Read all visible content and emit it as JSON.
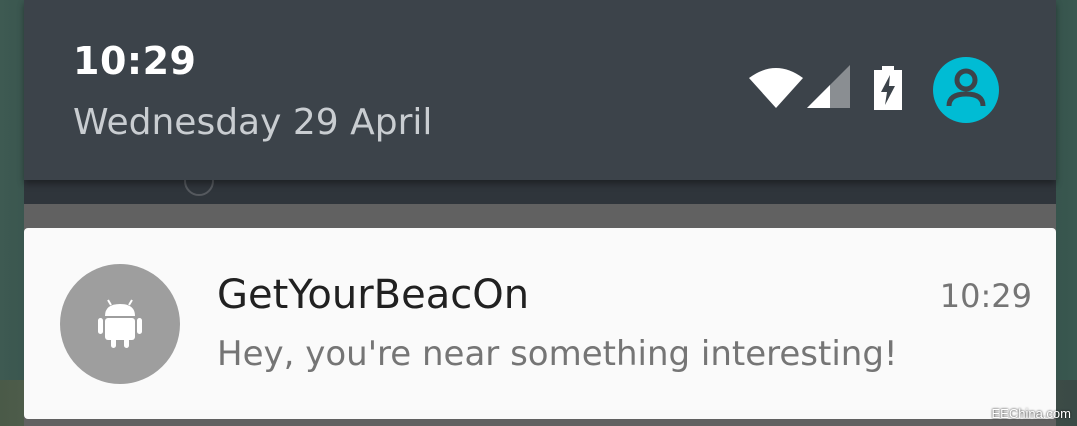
{
  "header": {
    "time": "10:29",
    "date": "Wednesday 29 April"
  },
  "status_icons": {
    "wifi": "wifi-icon",
    "signal": "cell-signal-icon",
    "battery": "battery-charging-icon",
    "user": "account-circle-icon"
  },
  "notification": {
    "app_icon": "android-icon",
    "title": "GetYourBeacOn",
    "time": "10:29",
    "text": "Hey, you're near something interesting!"
  },
  "colors": {
    "header_bg": "#3c434a",
    "accent": "#00bcd4",
    "card_bg": "#fafafa",
    "icon_circle": "#9e9e9e"
  },
  "watermark": "EEChina.com"
}
